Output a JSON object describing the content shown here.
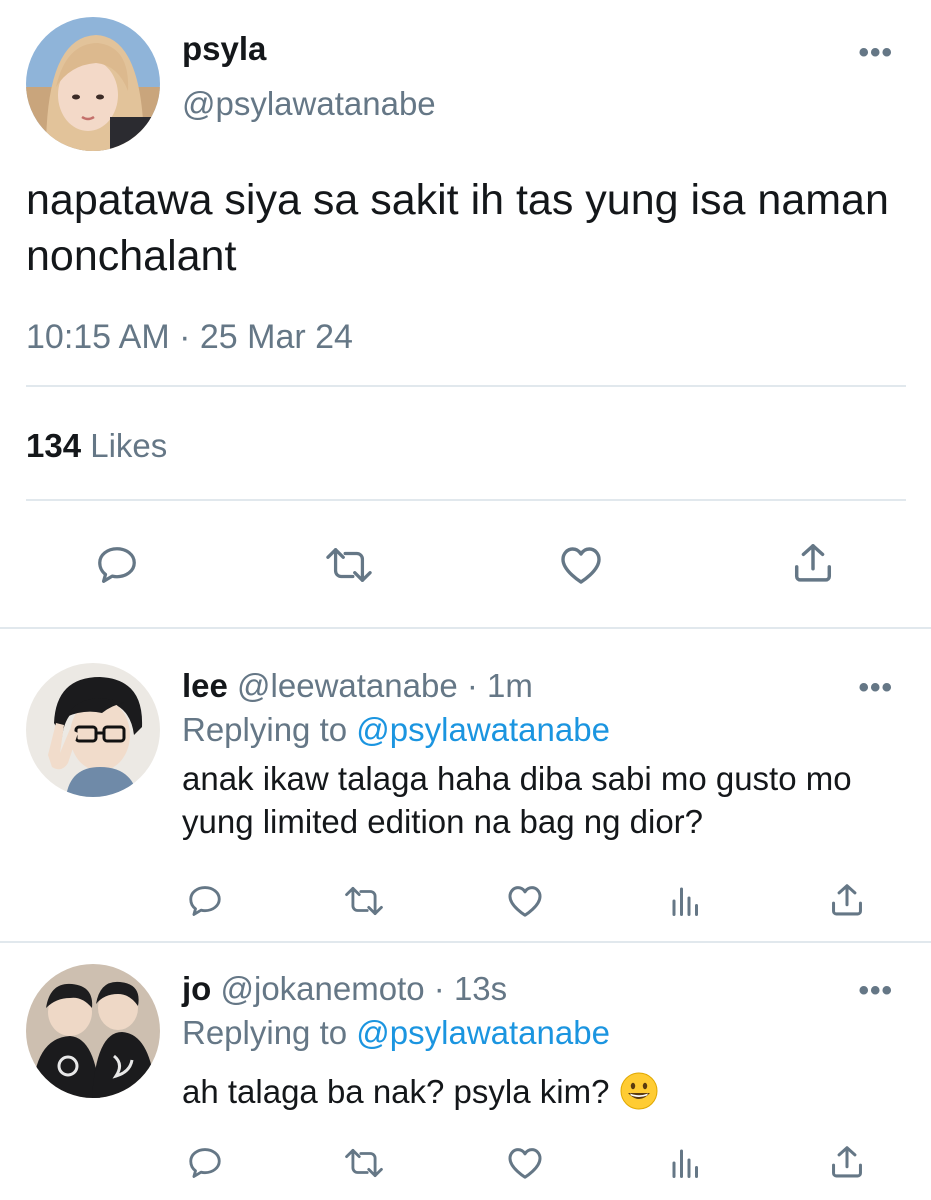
{
  "main_tweet": {
    "name": "psyla",
    "handle": "@psylawatanabe",
    "more_icon": "more-dots-icon",
    "text": "napatawa siya sa sakit ih tas yung isa naman nonchalant",
    "timestamp": "10:15 AM · 25 Mar 24",
    "likes_count": "134",
    "likes_label": "Likes",
    "actions": [
      "reply-icon",
      "retweet-icon",
      "like-icon",
      "share-icon"
    ]
  },
  "replies": [
    {
      "name": "lee",
      "handle": "@leewatanabe",
      "separator": "·",
      "time": "1m",
      "replying_prefix": "Replying to",
      "replying_handle": "@psylawatanabe",
      "text": "anak ikaw talaga haha diba sabi mo gusto mo yung limited edition na bag ng dior?",
      "actions": [
        "reply-icon",
        "retweet-icon",
        "like-icon",
        "analytics-icon",
        "share-icon"
      ]
    },
    {
      "name": "jo",
      "handle": "@jokanemoto",
      "separator": "·",
      "time": "13s",
      "replying_prefix": "Replying to",
      "replying_handle": "@psylawatanabe",
      "text": "ah talaga ba nak? psyla kim?",
      "emoji": "grinning-face-emoji",
      "actions": [
        "reply-icon",
        "retweet-icon",
        "like-icon",
        "analytics-icon",
        "share-icon"
      ]
    }
  ],
  "colors": {
    "text": "#14171a",
    "secondary": "#657786",
    "link": "#1b95e0",
    "divider": "#e1e8ed"
  }
}
